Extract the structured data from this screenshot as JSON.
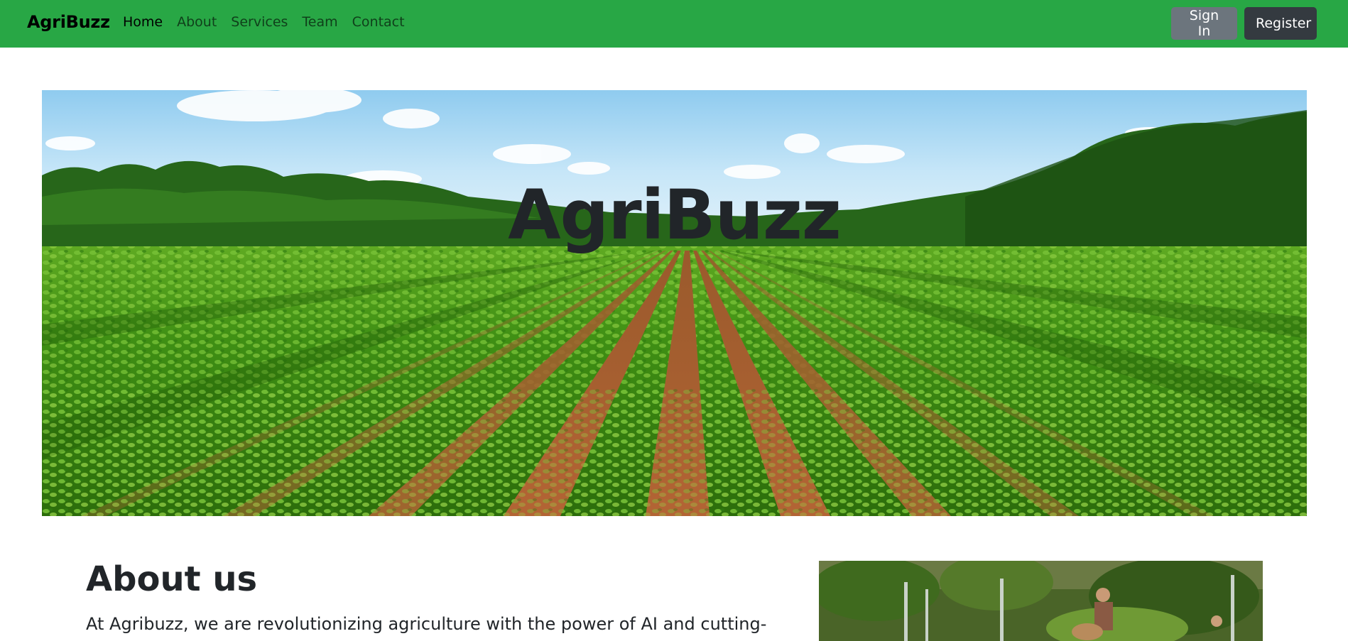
{
  "navbar": {
    "brand": "AgriBuzz",
    "links": [
      {
        "label": "Home",
        "active": true
      },
      {
        "label": "About",
        "active": false
      },
      {
        "label": "Services",
        "active": false
      },
      {
        "label": "Team",
        "active": false
      },
      {
        "label": "Contact",
        "active": false
      }
    ],
    "signin_label": "Sign In",
    "register_label": "Register",
    "background_color": "#28a745"
  },
  "hero": {
    "title": "AgriBuzz",
    "image": "farm-field-crop-rows-image"
  },
  "about": {
    "heading": "About us",
    "text": "At Agribuzz, we are revolutionizing agriculture with the power of AI and cutting-",
    "image": "community-garden-image"
  },
  "colors": {
    "signin_button": "#6c757d",
    "register_button": "#343a40",
    "text": "#212529"
  }
}
